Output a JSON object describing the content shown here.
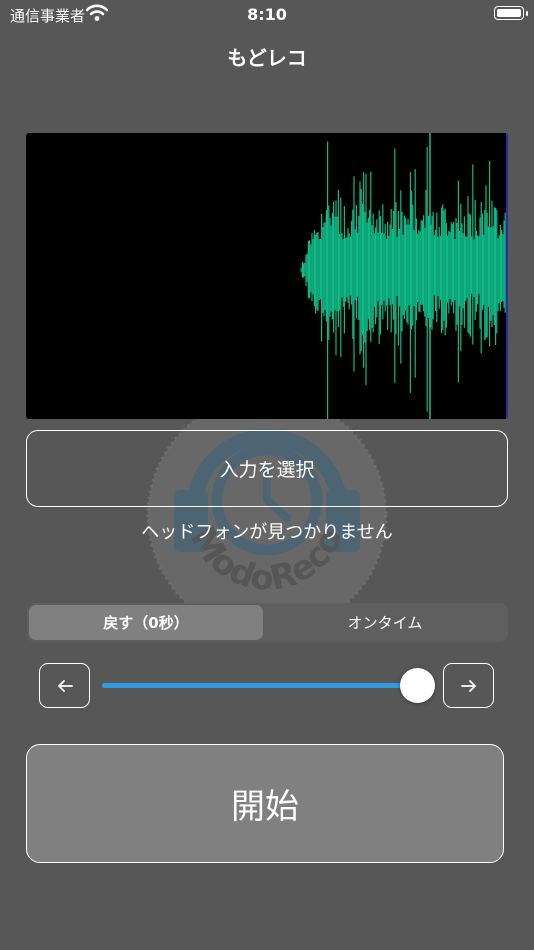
{
  "status_bar": {
    "carrier": "通信事業者",
    "time": "8:10",
    "wifi_icon": "wifi-icon",
    "battery_icon": "battery-icon"
  },
  "nav": {
    "title": "もどレコ"
  },
  "watermark": {
    "text": "ModoReco",
    "icon": "headphone-clock-logo"
  },
  "waveform": {
    "color": "#0fb886",
    "background": "#000000"
  },
  "input_button": {
    "label": "入力を選択"
  },
  "headphone_status": "ヘッドフォンが見つかりません",
  "segmented": {
    "options": [
      "戻す（0秒）",
      "オンタイム"
    ],
    "selected": "戻す（0秒）"
  },
  "slider": {
    "left_icon": "arrow-left-icon",
    "right_icon": "arrow-right-icon",
    "value_fraction": 1.0,
    "accent": "#2f9be0"
  },
  "start_button": {
    "label": "開始"
  }
}
